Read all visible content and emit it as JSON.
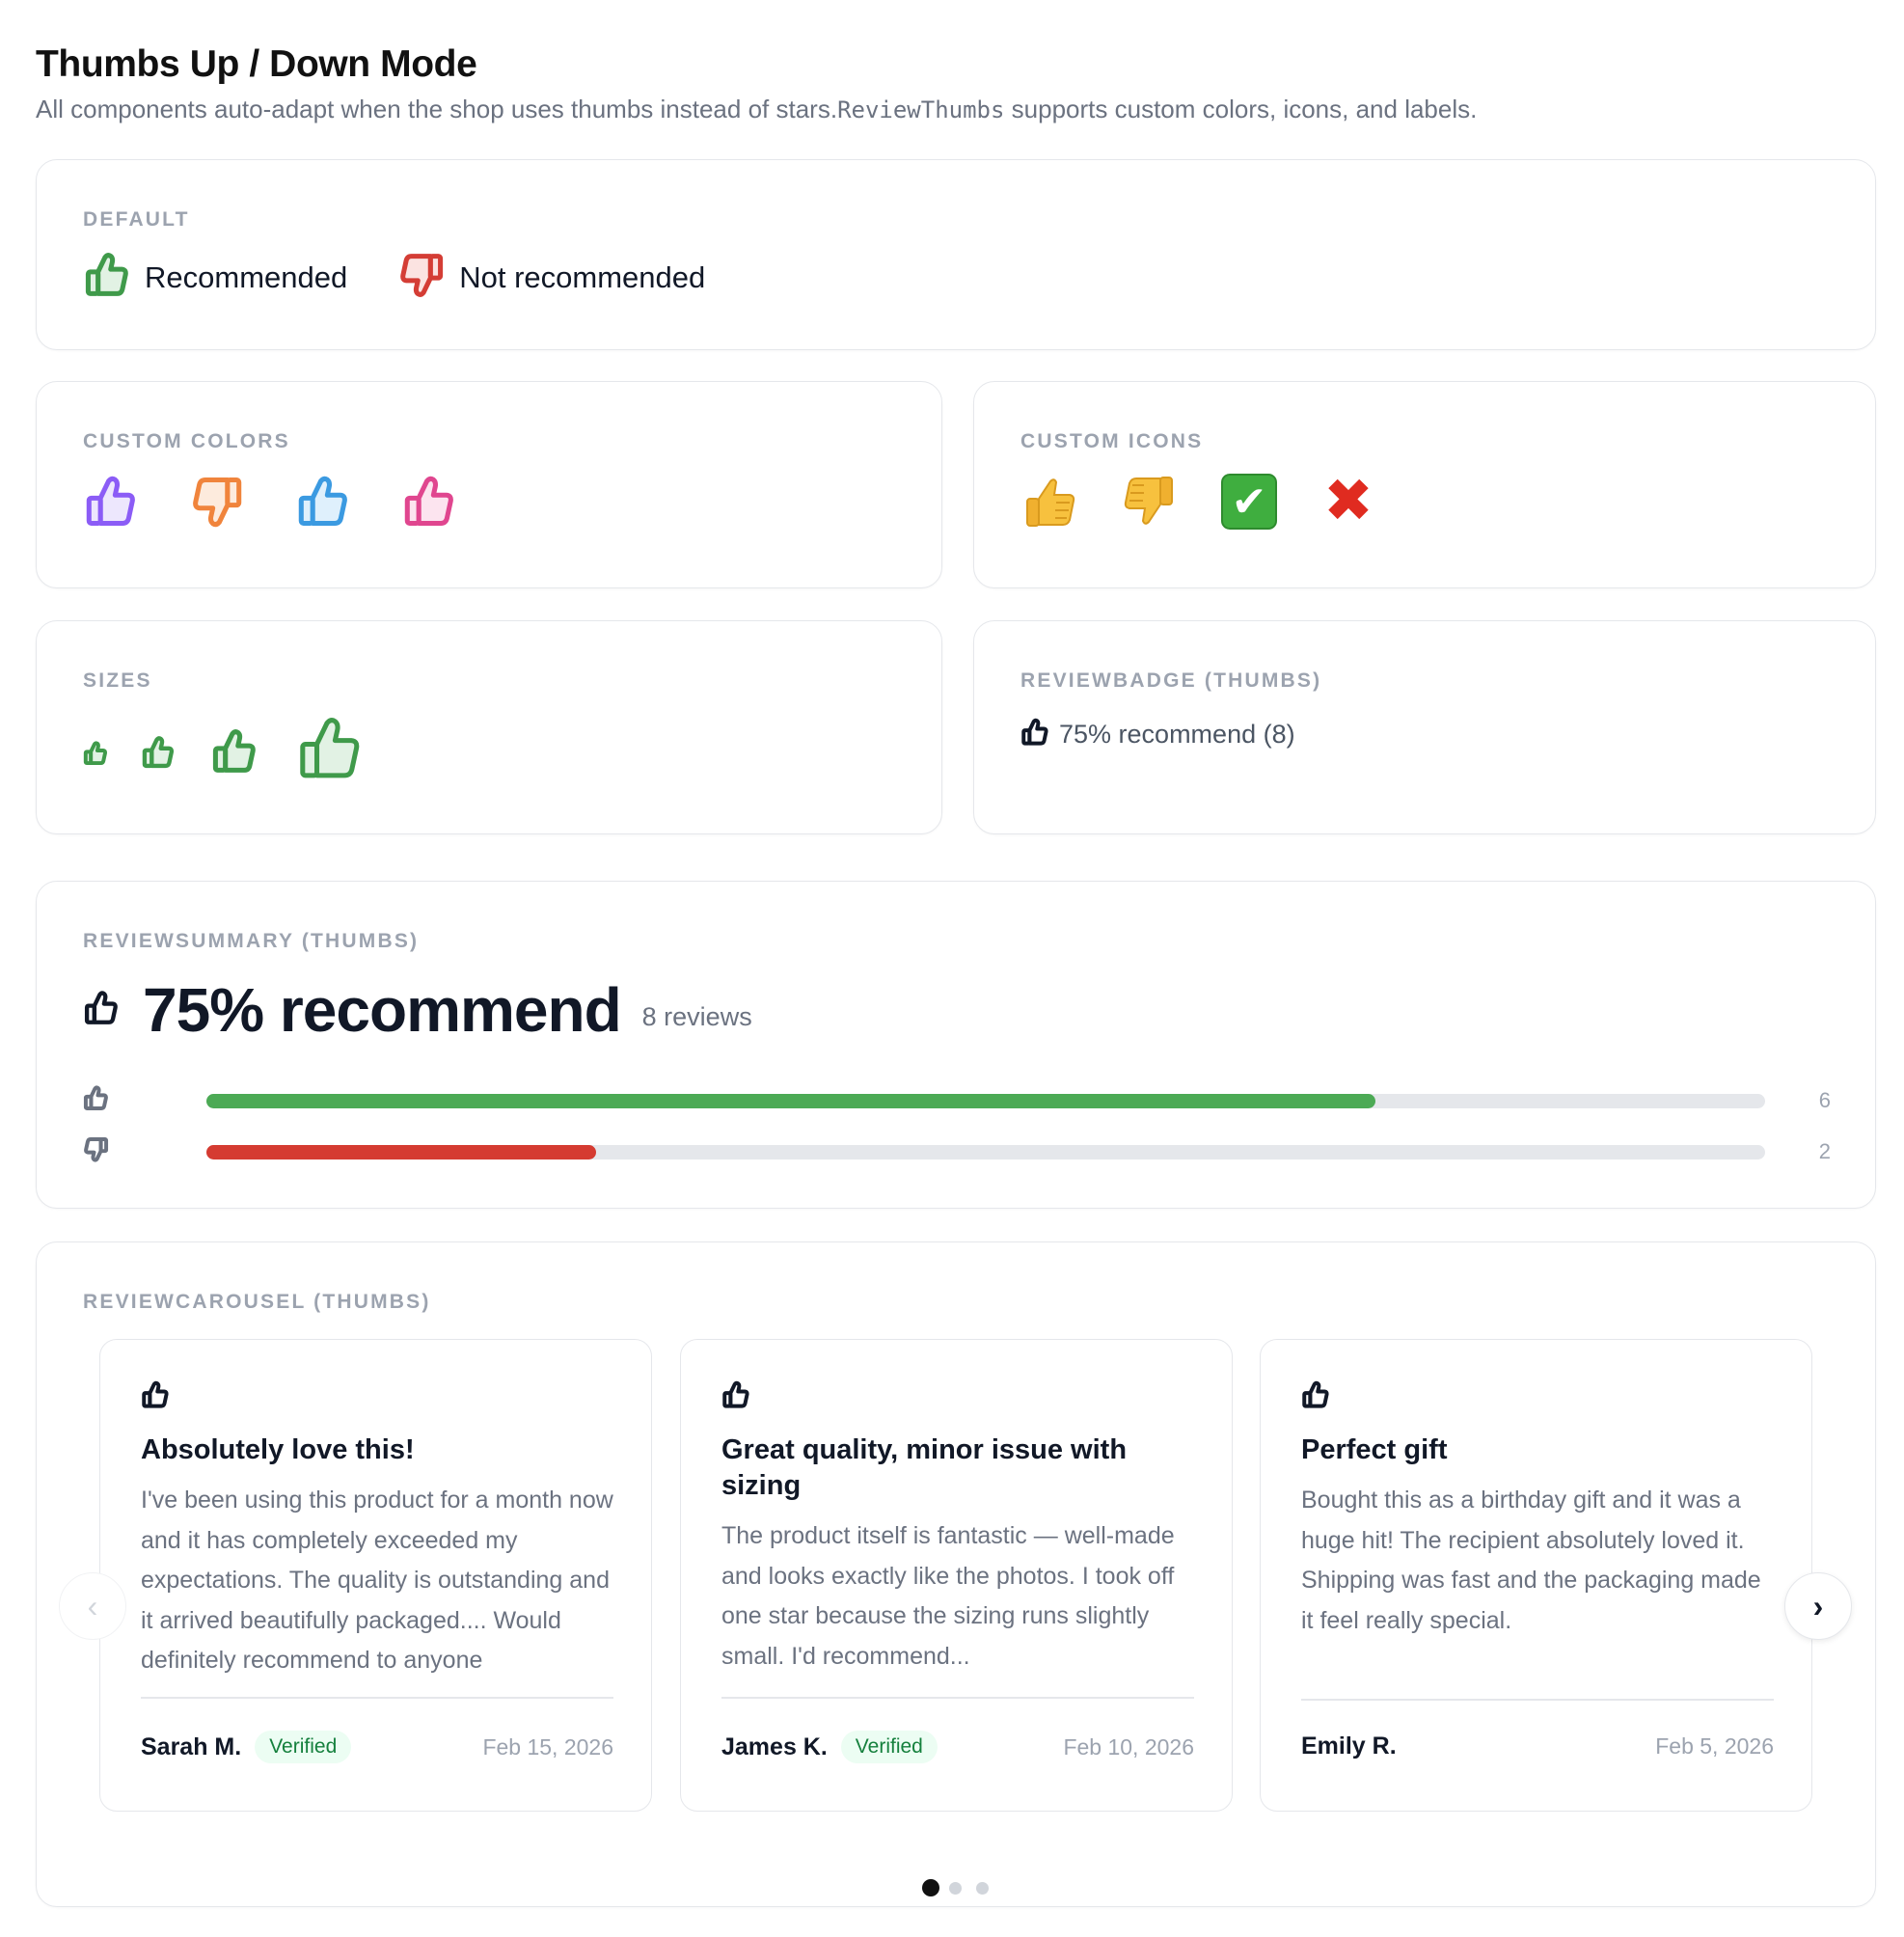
{
  "header": {
    "title": "Thumbs Up / Down Mode",
    "subtitle_part1": "All components auto-adapt when the shop uses thumbs instead of stars.",
    "subtitle_code": "ReviewThumbs",
    "subtitle_part2": " supports custom colors, icons, and labels."
  },
  "default_section": {
    "label": "Default",
    "items": [
      {
        "icon": "thumbs-up-icon",
        "label": "Recommended",
        "color": "#3f9a4a",
        "fill": "#e2f2e4"
      },
      {
        "icon": "thumbs-down-icon",
        "label": "Not recommended",
        "color": "#d43d35",
        "fill": "#fbe3e1"
      }
    ]
  },
  "custom_colors": {
    "label": "Custom Colors",
    "icons": [
      {
        "icon": "thumbs-up-icon",
        "color": "#8b5cf6",
        "fill": "#ede7fd"
      },
      {
        "icon": "thumbs-down-icon",
        "color": "#f0843c",
        "fill": "#fdebdd"
      },
      {
        "icon": "thumbs-up-icon",
        "color": "#3b9ae1",
        "fill": "#dff0fc"
      },
      {
        "icon": "thumbs-up-icon",
        "color": "#e0468f",
        "fill": "#fce4ef"
      }
    ]
  },
  "custom_icons": {
    "label": "Custom Icons",
    "icons": [
      "👍",
      "👎",
      "✔",
      "✖"
    ]
  },
  "sizes": {
    "label": "Sizes",
    "icons": [
      "small",
      "medium",
      "large",
      "x-large"
    ]
  },
  "badge": {
    "label": "ReviewBadge (thumbs)",
    "text": "75% recommend (8)"
  },
  "summary": {
    "label": "ReviewSummary (thumbs)",
    "headline": "75% recommend",
    "count": "8 reviews",
    "rows": [
      {
        "type": "up",
        "count": "6",
        "fraction": 0.75,
        "color": "#4caa55"
      },
      {
        "type": "down",
        "count": "2",
        "fraction": 0.25,
        "color": "#d53b31"
      }
    ]
  },
  "carousel": {
    "label": "ReviewCarousel (thumbs)",
    "prev": "‹",
    "next": "›",
    "reviews": [
      {
        "title": "Absolutely love this!",
        "body": "I've been using this product for a month now and it has completely exceeded my expectations. The quality is outstanding and it arrived beautifully packaged.... Would definitely recommend to anyone",
        "author": "Sarah M.",
        "verified": "Verified",
        "date": "Feb 15, 2026"
      },
      {
        "title": "Great quality, minor issue with sizing",
        "body": "The product itself is fantastic — well-made and looks exactly like the photos. I took off one star because the sizing runs slightly small. I'd recommend...",
        "author": "James K.",
        "verified": "Verified",
        "date": "Feb 10, 2026"
      },
      {
        "title": "Perfect gift",
        "body": "Bought this as a birthday gift and it was a huge hit! The recipient absolutely loved it. Shipping was fast and the packaging made it feel really special.",
        "author": "Emily R.",
        "verified": "",
        "date": "Feb 5, 2026"
      }
    ],
    "page_count": 3,
    "active_page": 1
  }
}
